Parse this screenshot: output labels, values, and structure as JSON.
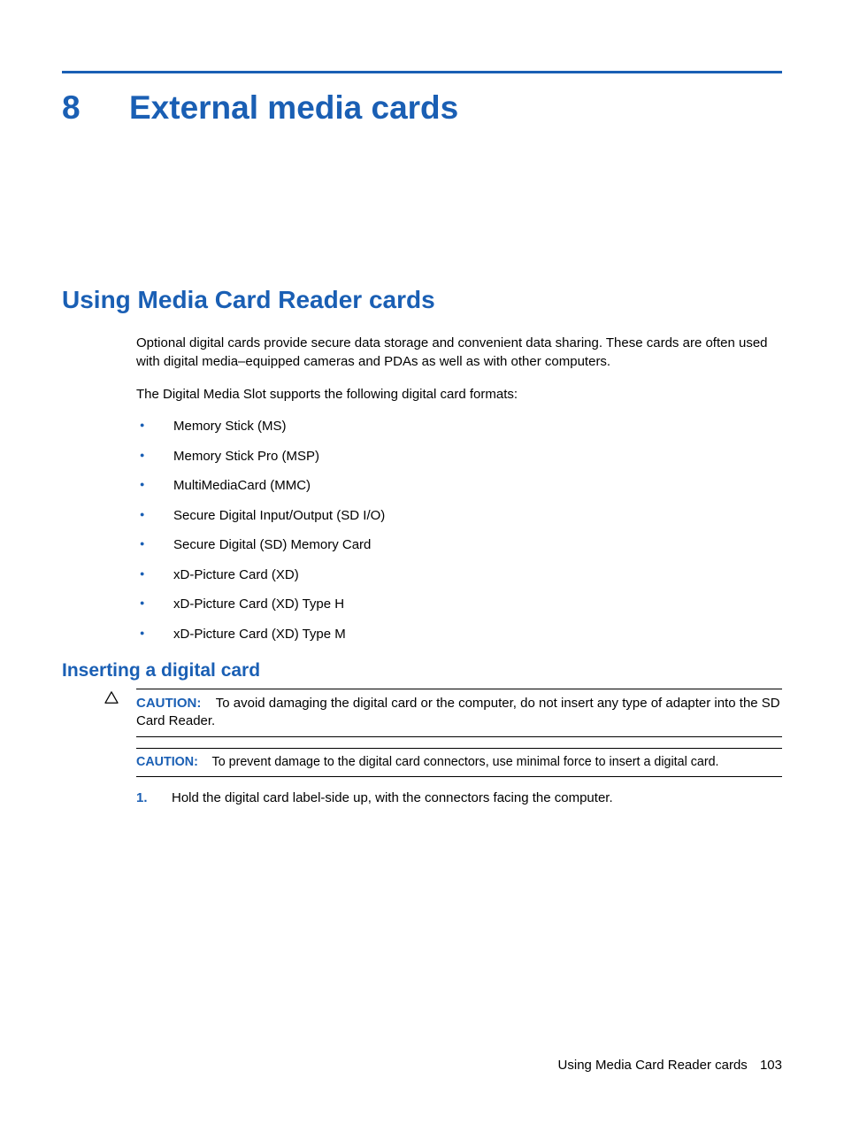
{
  "chapter": {
    "number": "8",
    "title": "External media cards"
  },
  "section": {
    "title": "Using Media Card Reader cards",
    "intro1": "Optional digital cards provide secure data storage and convenient data sharing. These cards are often used with digital media–equipped cameras and PDAs as well as with other computers.",
    "intro2": "The Digital Media Slot supports the following digital card formats:",
    "formats": [
      "Memory Stick (MS)",
      "Memory Stick Pro (MSP)",
      "MultiMediaCard (MMC)",
      "Secure Digital Input/Output (SD I/O)",
      "Secure Digital (SD) Memory Card",
      "xD-Picture Card (XD)",
      "xD-Picture Card (XD) Type H",
      "xD-Picture Card (XD) Type M"
    ]
  },
  "subsection": {
    "title": "Inserting a digital card",
    "caution1_label": "CAUTION:",
    "caution1_text": "To avoid damaging the digital card or the computer, do not insert any type of adapter into the SD Card Reader.",
    "caution2_label": "CAUTION:",
    "caution2_text": "To prevent damage to the digital card connectors, use minimal force to insert a digital card.",
    "steps": [
      {
        "num": "1.",
        "text": "Hold the digital card label-side up, with the connectors facing the computer."
      }
    ]
  },
  "footer": {
    "text": "Using Media Card Reader cards",
    "page": "103"
  }
}
